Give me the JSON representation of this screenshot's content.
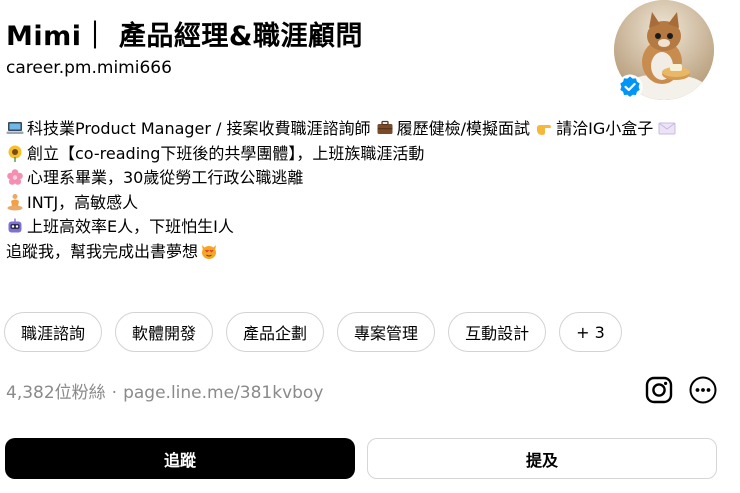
{
  "profile": {
    "name": "Mimi｜ 產品經理&職涯顧問",
    "username": "career.pm.mimi666",
    "avatar_alt": "avatar",
    "verified": true
  },
  "bio": {
    "line1": "科技業Product Manager / 接案收費職涯諮詢師",
    "line1b": "履歷健檢/模擬面試",
    "line1c": "請洽IG小盒子",
    "line2": "創立【co-reading下班後的共學團體】，上班族職涯活動",
    "line3": "心理系畢業，30歲從勞工行政公職逃離",
    "line4": "INTJ，高敏感人",
    "line5": "上班高效率E人，下班怕生I人",
    "line6": "追蹤我，幫我完成出書夢想"
  },
  "tags": [
    "職涯諮詢",
    "軟體開發",
    "產品企劃",
    "專案管理",
    "互動設計",
    "+ 3"
  ],
  "meta": {
    "followers": "4,382位粉絲",
    "separator": "·",
    "link": "page.line.me/381kvboy"
  },
  "buttons": {
    "follow": "追蹤",
    "mention": "提及"
  },
  "icons": {
    "instagram": "instagram-icon",
    "more": "more-icon"
  }
}
